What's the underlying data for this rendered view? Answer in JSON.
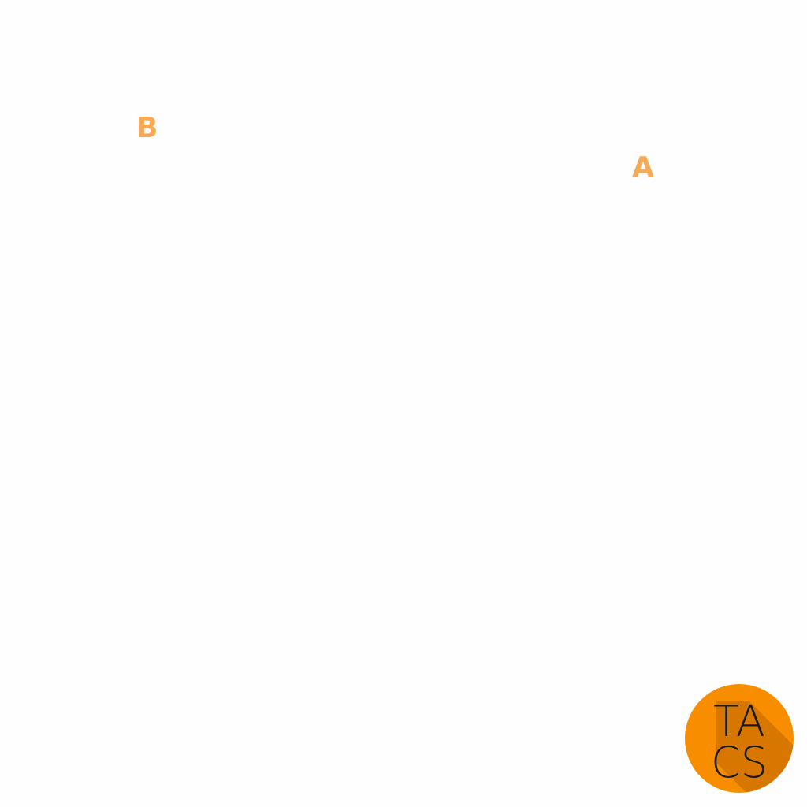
{
  "labels": {
    "b": "B",
    "a": "A"
  },
  "logo": {
    "text_line_1": "TA",
    "text_line_2": "CS",
    "colors": {
      "circle": "#f98d00",
      "shadow": "#d87700",
      "text": "#1a1a1a"
    }
  },
  "colors": {
    "label": "#f7aa55",
    "background": "#fefefe"
  }
}
